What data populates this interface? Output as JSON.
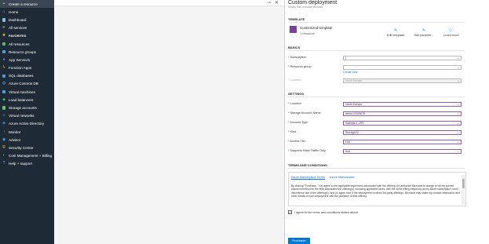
{
  "sidebar": {
    "items": [
      {
        "label": "Create a resource",
        "icon": "plus-icon",
        "color": "#7fd67f",
        "name": "create-a-resource"
      },
      {
        "label": "Home",
        "icon": "home-icon",
        "color": "#6ab0ff",
        "name": "home"
      },
      {
        "label": "Dashboard",
        "icon": "dashboard-icon",
        "color": "#8fb8e8",
        "name": "dashboard"
      },
      {
        "label": "All services",
        "icon": "list-icon",
        "color": "#cfd8e0",
        "name": "all-services"
      },
      {
        "label": "FAVORITES",
        "icon": "star-icon",
        "color": "#e8c14a",
        "name": "favorites"
      },
      {
        "label": "All resources",
        "icon": "grid-icon",
        "color": "#5fb85f",
        "name": "all-resources"
      },
      {
        "label": "Resource groups",
        "icon": "cube-icon",
        "color": "#4aa3df",
        "name": "resource-groups"
      },
      {
        "label": "App Services",
        "icon": "globe-icon",
        "color": "#4aa3df",
        "name": "app-services"
      },
      {
        "label": "Function Apps",
        "icon": "bolt-icon",
        "color": "#f2c811",
        "name": "function-apps"
      },
      {
        "label": "SQL databases",
        "icon": "database-icon",
        "color": "#4aa3df",
        "name": "sql-databases"
      },
      {
        "label": "Azure Cosmos DB",
        "icon": "planet-icon",
        "color": "#5fa8df",
        "name": "azure-cosmos-db"
      },
      {
        "label": "Virtual machines",
        "icon": "monitor-icon",
        "color": "#4aa3df",
        "name": "virtual-machines"
      },
      {
        "label": "Load balancers",
        "icon": "diamond-icon",
        "color": "#4ab04a",
        "name": "load-balancers"
      },
      {
        "label": "Storage accounts",
        "icon": "storage-icon",
        "color": "#6fb86f",
        "name": "storage-accounts"
      },
      {
        "label": "Virtual networks",
        "icon": "network-icon",
        "color": "#7ab0e0",
        "name": "virtual-networks"
      },
      {
        "label": "Azure Active Directory",
        "icon": "directory-icon",
        "color": "#4aa3df",
        "name": "azure-active-directory"
      },
      {
        "label": "Monitor",
        "icon": "gauge-icon",
        "color": "#4aa3df",
        "name": "monitor"
      },
      {
        "label": "Advisor",
        "icon": "advisor-icon",
        "color": "#4aa3df",
        "name": "advisor"
      },
      {
        "label": "Security Center",
        "icon": "shield-icon",
        "color": "#f2c811",
        "name": "security-center"
      },
      {
        "label": "Cost Management + Billing",
        "icon": "billing-icon",
        "color": "#5fb85f",
        "name": "cost-management-billing"
      },
      {
        "label": "Help + support",
        "icon": "help-icon",
        "color": "#6ab0ff",
        "name": "help-support"
      }
    ]
  },
  "background": {
    "pin_icon": "pin-icon",
    "close_icon": "close-icon"
  },
  "blade": {
    "title": "Custom deployment",
    "subtitle": "Deploy from a custom template",
    "template": {
      "section": "TEMPLATE",
      "name": "Customized template",
      "count": "1 resource",
      "actions": [
        {
          "label": "Edit template",
          "icon": "pencil-icon",
          "name": "edit-template"
        },
        {
          "label": "Edit paramet...",
          "icon": "pencil-icon",
          "name": "edit-parameters"
        },
        {
          "label": "Learn more",
          "icon": "info-icon",
          "name": "learn-more"
        }
      ]
    },
    "basics": {
      "section": "BASICS",
      "subscription": {
        "label": "Subscription",
        "value": "("
      },
      "resource_group": {
        "label": "Resource group",
        "value": "",
        "create_new": "Create new"
      },
      "location": {
        "label": "Location",
        "value": "North Europe"
      }
    },
    "settings": {
      "section": "SETTINGS",
      "location": {
        "label": "Location",
        "value": "North Europe"
      },
      "storage_account_name": {
        "label": "Storage Account Name",
        "value": "demo12345678"
      },
      "account_type": {
        "label": "Account Type",
        "value": "Standard_LRS"
      },
      "kind": {
        "label": "Kind",
        "value": "StorageV2"
      },
      "access_tier": {
        "label": "Access Tier",
        "value": "Hot"
      },
      "https_only": {
        "label": "Supports Https Traffic Only",
        "value": "true"
      }
    },
    "terms": {
      "section": "TERMS AND CONDITIONS",
      "tab1": "Azure Marketplace Terms",
      "tab2": "Azure Marketplace",
      "text": "By clicking \"Purchase,\" I (a) agree to the applicable legal terms associated with the offering; (b) authorize Microsoft to charge or bill my current payment method for the fees associated the offering(s), including applicable taxes, with the same billing frequency as my Azure subscription, until I discontinue use of the offering(s); and (c) agree that, if the deployment involves 3rd party offerings, Microsoft may share my contact information and other details of such deployment with the publisher of that offering.",
      "agree_label": "I agree to the terms and conditions stated above",
      "agree_checked": "✓"
    },
    "purchase_label": "Purchase"
  },
  "colors": {
    "sidebar_bg": "#1e2a35",
    "accent": "#0078d4",
    "template_icon": "#7b3fa0"
  }
}
